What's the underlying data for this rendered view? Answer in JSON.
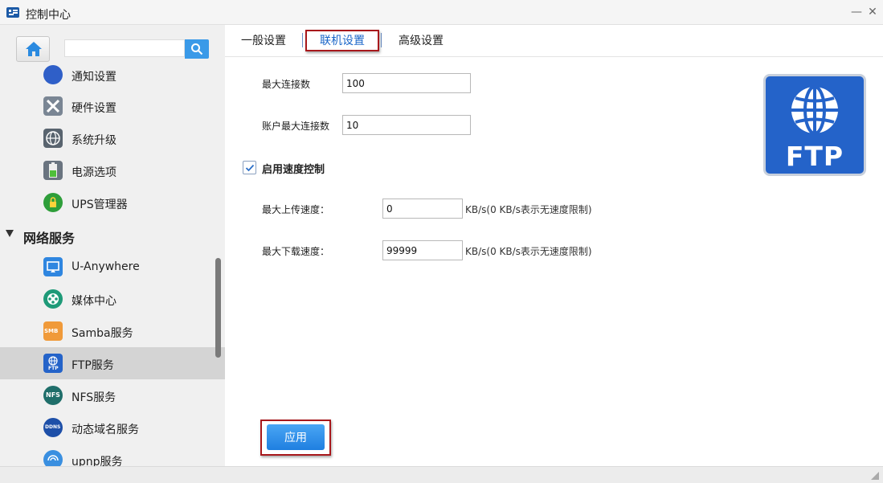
{
  "window": {
    "title": "控制中心"
  },
  "sidebar": {
    "search": {
      "value": "",
      "placeholder": ""
    },
    "items_top": [
      {
        "label": "通知设置",
        "icon": "bell-gear-icon"
      },
      {
        "label": "硬件设置",
        "icon": "wrench-screwdriver-icon"
      },
      {
        "label": "系统升级",
        "icon": "globe-upgrade-icon"
      },
      {
        "label": "电源选项",
        "icon": "battery-icon"
      },
      {
        "label": "UPS管理器",
        "icon": "ups-power-icon"
      }
    ],
    "section": {
      "label": "网络服务",
      "expanded": true
    },
    "items_network": [
      {
        "label": "U-Anywhere",
        "icon": "monitor-icon"
      },
      {
        "label": "媒体中心",
        "icon": "film-reel-icon"
      },
      {
        "label": "Samba服务",
        "icon": "samba-folder-icon",
        "badge": "SMB"
      },
      {
        "label": "FTP服务",
        "icon": "ftp-globe-icon",
        "badge": "FTP",
        "active": true
      },
      {
        "label": "NFS服务",
        "icon": "nfs-icon",
        "badge": "NFS"
      },
      {
        "label": "动态域名服务",
        "icon": "ddns-icon",
        "badge": "DDNS"
      },
      {
        "label": "upnp服务",
        "icon": "upnp-icon"
      }
    ]
  },
  "tabs": [
    {
      "label": "一般设置",
      "active": false
    },
    {
      "label": "联机设置",
      "active": true
    },
    {
      "label": "高级设置",
      "active": false
    }
  ],
  "form": {
    "max_connections": {
      "label": "最大连接数",
      "value": "100"
    },
    "max_account_connections": {
      "label": "账户最大连接数",
      "value": "10"
    },
    "speed_control": {
      "label": "启用速度控制",
      "checked": true
    },
    "max_upload": {
      "label": "最大上传速度：",
      "value": "0",
      "hint": "KB/s(0 KB/s表示无速度限制)"
    },
    "max_download": {
      "label": "最大下载速度：",
      "value": "99999",
      "hint": "KB/s(0 KB/s表示无速度限制)"
    }
  },
  "logo": {
    "text": "FTP"
  },
  "apply_label": "应用",
  "colors": {
    "accent": "#1a66c8",
    "button": "#2f8ff0",
    "highlight": "#a8181c",
    "logo_bg": "#2463c9"
  }
}
